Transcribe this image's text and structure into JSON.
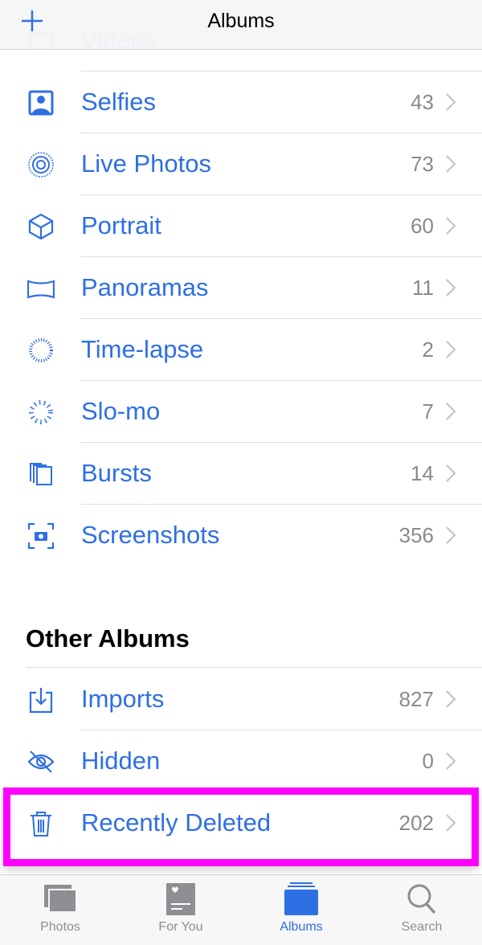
{
  "header": {
    "title": "Albums",
    "add_icon": "plus-icon"
  },
  "media_types": [
    {
      "label": "Videos",
      "count": "",
      "icon": "video-icon"
    },
    {
      "label": "Selfies",
      "count": "43",
      "icon": "selfie-icon"
    },
    {
      "label": "Live Photos",
      "count": "73",
      "icon": "live-photo-icon"
    },
    {
      "label": "Portrait",
      "count": "60",
      "icon": "cube-icon"
    },
    {
      "label": "Panoramas",
      "count": "11",
      "icon": "panorama-icon"
    },
    {
      "label": "Time-lapse",
      "count": "2",
      "icon": "timelapse-icon"
    },
    {
      "label": "Slo-mo",
      "count": "7",
      "icon": "slomo-icon"
    },
    {
      "label": "Bursts",
      "count": "14",
      "icon": "bursts-icon"
    },
    {
      "label": "Screenshots",
      "count": "356",
      "icon": "screenshot-icon"
    }
  ],
  "other_albums": {
    "title": "Other Albums",
    "items": [
      {
        "label": "Imports",
        "count": "827",
        "icon": "import-icon"
      },
      {
        "label": "Hidden",
        "count": "0",
        "icon": "hidden-icon"
      },
      {
        "label": "Recently Deleted",
        "count": "202",
        "icon": "trash-icon",
        "highlighted": true
      }
    ]
  },
  "tabs": [
    {
      "label": "Photos",
      "icon": "photos-icon"
    },
    {
      "label": "For You",
      "icon": "for-you-icon"
    },
    {
      "label": "Albums",
      "icon": "albums-icon",
      "active": true
    },
    {
      "label": "Search",
      "icon": "search-icon"
    }
  ],
  "colors": {
    "accent": "#2f6fe4",
    "highlight": "#ff00ff",
    "count": "#8a8a8e"
  }
}
